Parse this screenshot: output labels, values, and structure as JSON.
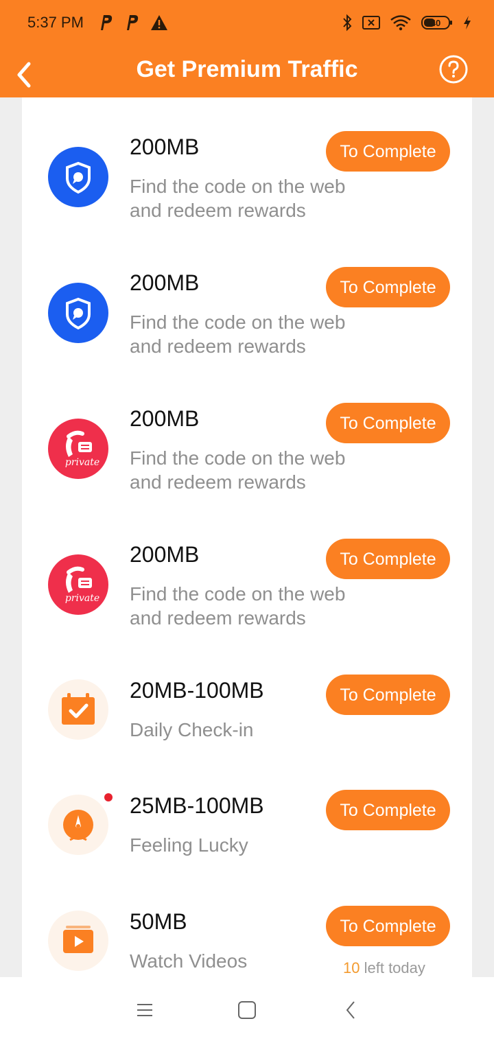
{
  "status_bar": {
    "time": "5:37 PM",
    "left_icons": [
      "parking-icon",
      "parking-icon",
      "warning-icon"
    ],
    "right_icons": [
      "bluetooth-icon",
      "sim-off-icon",
      "wifi-icon",
      "battery-icon",
      "charging-icon"
    ],
    "battery_level": "40"
  },
  "header": {
    "title": "Get Premium Traffic",
    "back_icon": "chevron-left-icon",
    "help_icon": "help-circle-icon"
  },
  "tasks": [
    {
      "amount": "200MB",
      "description": "Find the code on the web and redeem rewards",
      "button": "To Complete",
      "icon": "shield-chat-icon"
    },
    {
      "amount": "200MB",
      "description": "Find the code on the web and redeem rewards",
      "button": "To Complete",
      "icon": "shield-chat-icon"
    },
    {
      "amount": "200MB",
      "description": "Find the code on the web and redeem rewards",
      "button": "To Complete",
      "icon": "private-phone-icon",
      "icon_text": "private"
    },
    {
      "amount": "200MB",
      "description": "Find the code on the web and redeem rewards",
      "button": "To Complete",
      "icon": "private-phone-icon",
      "icon_text": "private"
    },
    {
      "amount": "20MB-100MB",
      "description": "Daily Check-in",
      "button": "To Complete",
      "icon": "calendar-check-icon"
    },
    {
      "amount": "25MB-100MB",
      "description": "Feeling Lucky",
      "button": "To Complete",
      "icon": "lucky-wheel-icon",
      "badge": "red-dot"
    },
    {
      "amount": "50MB",
      "description": "Watch Videos",
      "button": "To Complete",
      "icon": "video-play-icon",
      "remaining_count": "10",
      "remaining_label": "left today"
    }
  ],
  "colors": {
    "accent": "#fb8022",
    "shield_blue": "#1b5ef0",
    "private_red": "#ef2f4b",
    "muted_text": "#8f8f8f"
  },
  "nav_bar": [
    "menu-icon",
    "home-square-icon",
    "back-icon"
  ]
}
